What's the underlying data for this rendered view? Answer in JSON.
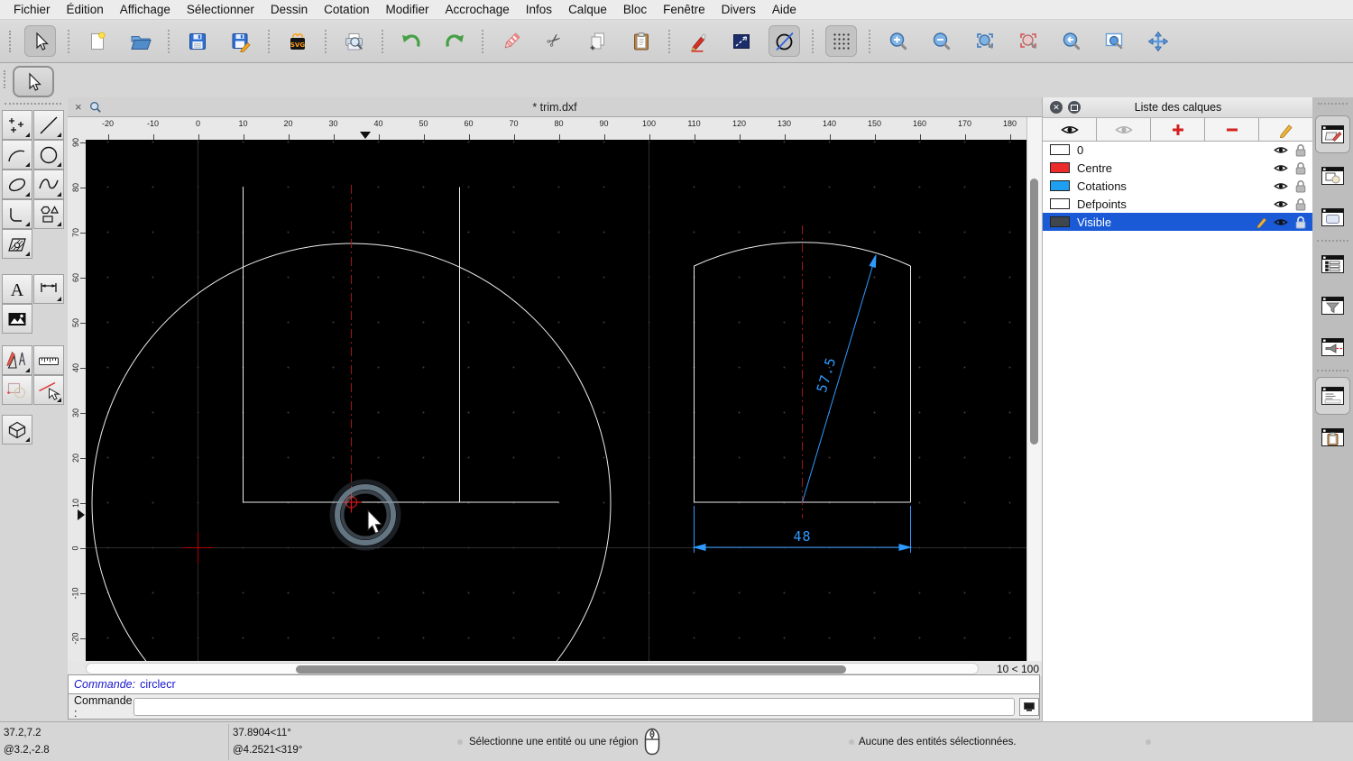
{
  "menu": {
    "items": [
      "Fichier",
      "Édition",
      "Affichage",
      "Sélectionner",
      "Dessin",
      "Cotation",
      "Modifier",
      "Accrochage",
      "Infos",
      "Calque",
      "Bloc",
      "Fenêtre",
      "Divers",
      "Aide"
    ]
  },
  "toolbar": {
    "items": [
      {
        "icon": "select-cursor",
        "selected": true
      },
      {
        "sep": true
      },
      {
        "icon": "new-document"
      },
      {
        "icon": "open-file"
      },
      {
        "sep": true
      },
      {
        "icon": "save"
      },
      {
        "icon": "save-as"
      },
      {
        "sep": true
      },
      {
        "icon": "svg-export"
      },
      {
        "sep": true
      },
      {
        "icon": "print-preview"
      },
      {
        "sep": true
      },
      {
        "icon": "undo"
      },
      {
        "icon": "redo"
      },
      {
        "sep": true
      },
      {
        "icon": "eraser"
      },
      {
        "icon": "cut"
      },
      {
        "icon": "copy"
      },
      {
        "icon": "paste"
      },
      {
        "sep": true
      },
      {
        "icon": "draw-pen"
      },
      {
        "icon": "ortho-line"
      },
      {
        "icon": "circle-line",
        "selected": true
      },
      {
        "sep": true
      },
      {
        "icon": "snap-grid",
        "selected": true
      },
      {
        "sep": true
      },
      {
        "icon": "zoom-in"
      },
      {
        "icon": "zoom-out"
      },
      {
        "icon": "zoom-auto"
      },
      {
        "icon": "zoom-selection"
      },
      {
        "icon": "zoom-previous"
      },
      {
        "icon": "zoom-window"
      },
      {
        "icon": "zoom-pan"
      }
    ]
  },
  "subtoolbar": {
    "icon": "select-cursor",
    "selected": true
  },
  "palette": {
    "items": [
      {
        "icon": "points"
      },
      {
        "icon": "line"
      },
      {
        "icon": "arc"
      },
      {
        "icon": "circle"
      },
      {
        "icon": "ellipse"
      },
      {
        "icon": "spline"
      },
      {
        "icon": "polyline"
      },
      {
        "icon": "shapes"
      },
      {
        "icon": "hatch"
      },
      {
        "icon": "text"
      },
      {
        "icon": "dimension"
      },
      {
        "icon": "image"
      },
      {
        "icon": "edit-tools"
      },
      {
        "icon": "measure"
      },
      {
        "icon": "shape-info"
      },
      {
        "icon": "trim"
      },
      {
        "icon": "iso-box"
      }
    ]
  },
  "tab": {
    "close": "×",
    "title": "* trim.dxf"
  },
  "rulers": {
    "horizontal": [
      "-20",
      "-10",
      "0",
      "10",
      "20",
      "30",
      "40",
      "50",
      "60",
      "70",
      "80",
      "90",
      "100",
      "110",
      "120",
      "130",
      "140",
      "150",
      "160",
      "170",
      "180"
    ],
    "vertical": [
      "90",
      "80",
      "70",
      "60",
      "50",
      "40",
      "30",
      "20",
      "10",
      "0",
      "-10",
      "-20"
    ]
  },
  "drawing": {
    "dim_radius": "57.5",
    "dim_width": "48"
  },
  "viewport": {
    "grid_status": "10 < 100"
  },
  "layers_panel": {
    "title": "Liste des calques",
    "toolbar": [
      {
        "icon": "eye-on"
      },
      {
        "icon": "eye-off"
      },
      {
        "icon": "layer-add"
      },
      {
        "icon": "layer-remove"
      },
      {
        "icon": "layer-edit"
      }
    ],
    "layers": [
      {
        "name": "0",
        "color": "#ffffff",
        "selected": false
      },
      {
        "name": "Centre",
        "color": "#ec2b2b",
        "selected": false
      },
      {
        "name": "Cotations",
        "color": "#1e9ff2",
        "selected": false
      },
      {
        "name": "Defpoints",
        "color": "#ffffff",
        "selected": false
      },
      {
        "name": "Visible",
        "color": "#3f464d",
        "selected": true
      }
    ]
  },
  "dock": {
    "items": [
      {
        "icon": "dock-layers",
        "selected": true
      },
      {
        "icon": "dock-blocks",
        "selected": false
      },
      {
        "icon": "dock-library",
        "selected": false
      },
      {
        "icon": "dock-list",
        "selected": false
      },
      {
        "icon": "dock-filter",
        "selected": false
      },
      {
        "icon": "dock-pen",
        "selected": false
      },
      {
        "icon": "dock-command",
        "selected": true
      },
      {
        "icon": "dock-clipboard",
        "selected": false
      }
    ]
  },
  "command": {
    "history_label": "Commande:",
    "history_value": "circlecr",
    "prompt": "Commande :",
    "input_value": ""
  },
  "status": {
    "abs_coord": "37.2,7.2",
    "rel_coord": "@3.2,-2.8",
    "abs_polar": "37.8904<11°",
    "rel_polar": "@4.2521<319°",
    "hint": "Sélectionne une entité ou une région",
    "selection_info": "Aucune des entités sélectionnées."
  },
  "colors": {
    "dimension_blue": "#2f9bff",
    "centerline_red": "#a31515",
    "selection_blue": "#1b5ad6",
    "canvas_background": "#000000",
    "origin_cross_red": "#b40000",
    "drawing_white": "#ededed"
  }
}
